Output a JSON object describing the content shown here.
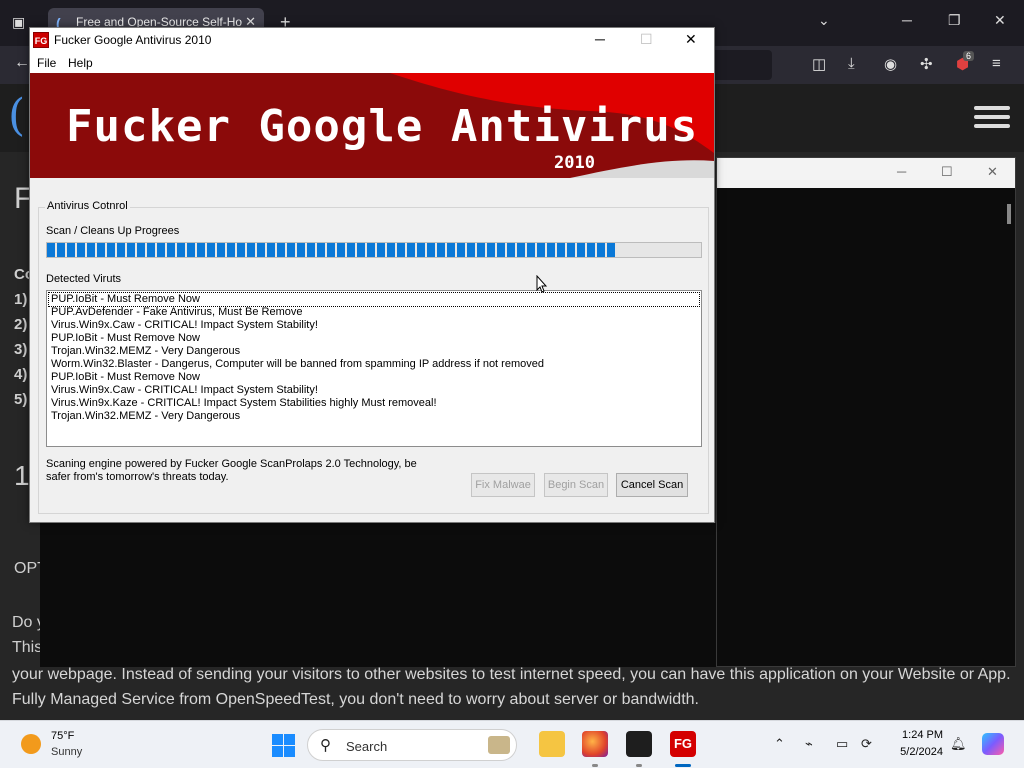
{
  "browser": {
    "tab_title": "Free and Open-Source Self-Ho",
    "tab_close": "✕",
    "new_tab": "+",
    "extension_badge": "6"
  },
  "webpage": {
    "logo_glyph": "(",
    "left_fragments": [
      "F",
      "Co",
      "1)",
      "2)",
      "3)",
      "4)",
      "5)",
      "1",
      "OPT",
      "Do y",
      "This"
    ],
    "paragraph": "your webpage. Instead of sending your visitors to other websites to test internet speed, you can have this application on your Website or App. Fully Managed Service from OpenSpeedTest, you don't need to worry about server or bandwidth."
  },
  "antivirus": {
    "icon_text": "FG",
    "title": "Fucker Google Antivirus 2010",
    "menu": [
      "File",
      "Help"
    ],
    "banner_title": "Fucker Google Antivirus",
    "banner_year": "2010",
    "group_label": "Antivirus Cotnrol",
    "progress_label": "Scan / Cleans Up Progrees",
    "progress_fraction": 0.87,
    "detected_label": "Detected Viruts",
    "viruses": [
      "PUP.IoBit - Must Remove Now",
      "PUP.AvDefender - Fake Antivirus, Must Be Remove",
      "Virus.Win9x.Caw - CRITICAL! Impact System Stability!",
      "PUP.IoBit - Must Remove Now",
      "Trojan.Win32.MEMZ - Very Dangerous",
      "Worm.Win32.Blaster - Dangerus, Computer will be banned from spamming IP address if not removed",
      "PUP.IoBit - Must Remove Now",
      "Virus.Win9x.Caw - CRITICAL! Impact System Stability!",
      "Virus.Win9x.Kaze - CRITICAL! Impact System Stabilities highly Must removeal!",
      "Trojan.Win32.MEMZ - Very Dangerous"
    ],
    "footer_text": "Scaning engine powered by Fucker Google ScanProlaps 2.0 Technology, be safer from's tomorrow's threats today.",
    "buttons": {
      "fix": "Fix Malwae",
      "begin": "Begin Scan",
      "cancel": "Cancel Scan"
    }
  },
  "taskbar": {
    "weather_temp": "75°F",
    "weather_cond": "Sunny",
    "search_placeholder": "Search",
    "time": "1:24 PM",
    "date": "5/2/2024"
  },
  "colors": {
    "banner_red": "#e00000",
    "banner_dark": "#8b0a0a",
    "progress_blue": "#0a78d7",
    "taskbar_bg": "#eef1f6"
  }
}
